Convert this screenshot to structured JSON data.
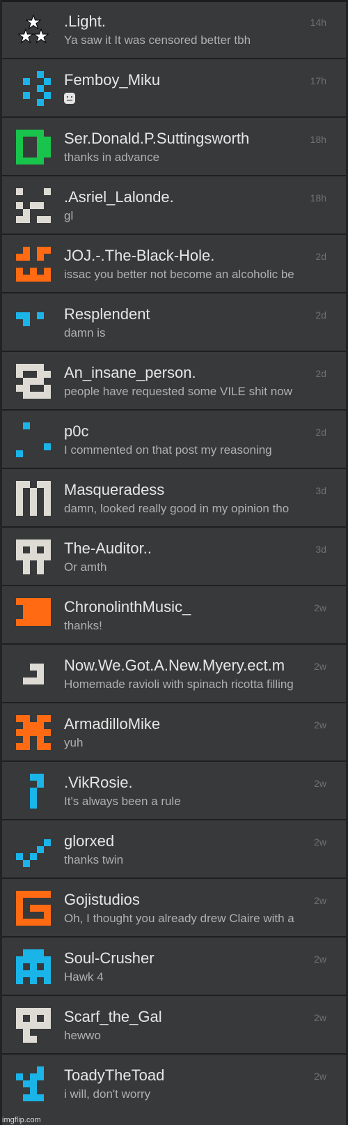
{
  "conversations": [
    {
      "name": ".Light.",
      "message": "Ya saw it It was censored better tbh",
      "time": "14h",
      "avatar_icon": "stars-icon",
      "avatar_color": "#ffffff"
    },
    {
      "name": "Femboy_Miku",
      "message": "",
      "time": "17h",
      "avatar_icon": "pixel-pattern-icon",
      "avatar_color": "#1ab4e8",
      "message_icon": "sticker-emoji-icon"
    },
    {
      "name": "Ser.Donald.P.Suttingsworth",
      "message": "thanks in advance",
      "time": "18h",
      "avatar_icon": "pixel-pattern-icon",
      "avatar_color": "#19c44c"
    },
    {
      "name": ".Asriel_Lalonde.",
      "message": "gl",
      "time": "18h",
      "avatar_icon": "pixel-pattern-icon",
      "avatar_color": "#dddbd4"
    },
    {
      "name": "JOJ.-.The-Black-Hole.",
      "message": "issac you better not become an alcoholic be",
      "time": "2d",
      "avatar_icon": "pixel-pattern-icon",
      "avatar_color": "#ff6a13"
    },
    {
      "name": "Resplendent",
      "message": "damn is",
      "time": "2d",
      "avatar_icon": "pixel-pattern-icon",
      "avatar_color": "#1ab4e8"
    },
    {
      "name": "An_insane_person.",
      "message": "people have requested some VILE shit now",
      "time": "2d",
      "avatar_icon": "pixel-pattern-icon",
      "avatar_color": "#dddbd4"
    },
    {
      "name": "p0c",
      "message": "I commented on that post my reasoning",
      "time": "2d",
      "avatar_icon": "pixel-pattern-icon",
      "avatar_color": "#1ab4e8"
    },
    {
      "name": "Masqueradess",
      "message": "damn, looked really good in my opinion tho",
      "time": "3d",
      "avatar_icon": "pixel-pattern-icon",
      "avatar_color": "#dddbd4"
    },
    {
      "name": "The-Auditor..",
      "message": "Or amth",
      "time": "3d",
      "avatar_icon": "pixel-pattern-icon",
      "avatar_color": "#dddbd4"
    },
    {
      "name": "ChronolinthMusic_",
      "message": "thanks!",
      "time": "2w",
      "avatar_icon": "pixel-pattern-icon",
      "avatar_color": "#ff6a13"
    },
    {
      "name": "Now.We.Got.A.New.Myery.ect.m",
      "message": "Homemade ravioli with spinach ricotta filling",
      "time": "2w",
      "avatar_icon": "pixel-pattern-icon",
      "avatar_color": "#dddbd4"
    },
    {
      "name": "ArmadilloMike",
      "message": "yuh",
      "time": "2w",
      "avatar_icon": "pixel-pattern-icon",
      "avatar_color": "#ff6a13"
    },
    {
      "name": ".VikRosie.",
      "message": "It's always been a rule",
      "time": "2w",
      "avatar_icon": "pixel-pattern-icon",
      "avatar_color": "#1ab4e8"
    },
    {
      "name": "glorxed",
      "message": "thanks twin",
      "time": "2w",
      "avatar_icon": "pixel-pattern-icon",
      "avatar_color": "#1ab4e8"
    },
    {
      "name": "Gojistudios",
      "message": "Oh, I thought you already drew Claire with a",
      "time": "2w",
      "avatar_icon": "pixel-pattern-icon",
      "avatar_color": "#ff6a13"
    },
    {
      "name": "Soul-Crusher",
      "message": "Hawk 4",
      "time": "2w",
      "avatar_icon": "pixel-pattern-icon",
      "avatar_color": "#1ab4e8"
    },
    {
      "name": "Scarf_the_Gal",
      "message": "hewwo",
      "time": "2w",
      "avatar_icon": "pixel-pattern-icon",
      "avatar_color": "#dddbd4"
    },
    {
      "name": "ToadyTheToad",
      "message": "i will, don't worry",
      "time": "2w",
      "avatar_icon": "pixel-pattern-icon",
      "avatar_color": "#1ab4e8"
    }
  ],
  "watermark": "imgflip.com"
}
